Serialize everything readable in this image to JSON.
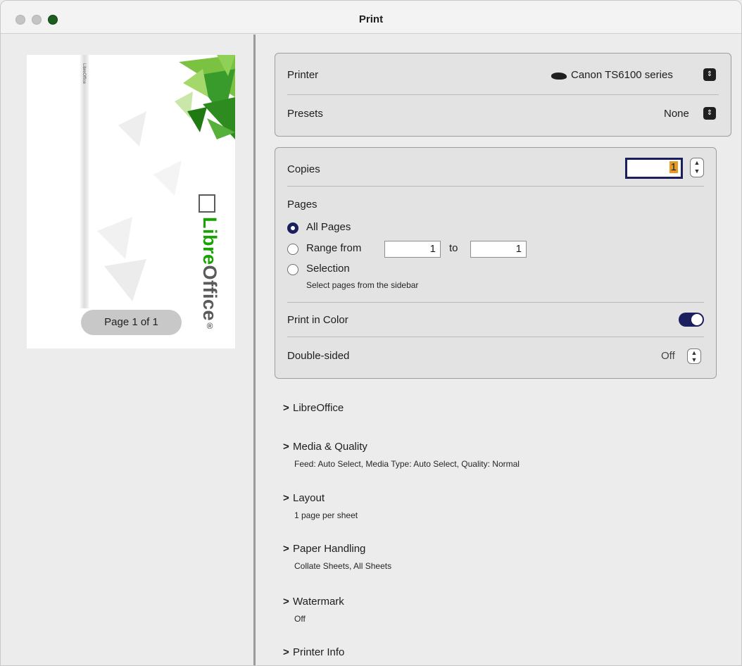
{
  "window": {
    "title": "Print"
  },
  "preview": {
    "spine_text": "LibreOffice",
    "logo_text_libre": "Libre",
    "logo_text_office": "Office",
    "logo_mark": "®",
    "page_indicator": "Page 1 of 1"
  },
  "printer_panel": {
    "printer_label": "Printer",
    "printer_value": "Canon TS6100 series",
    "presets_label": "Presets",
    "presets_value": "None"
  },
  "main_panel": {
    "copies_label": "Copies",
    "copies_value": "1",
    "pages_label": "Pages",
    "radio_all": "All Pages",
    "radio_range": "Range from",
    "range_from": "1",
    "range_to_label": "to",
    "range_to": "1",
    "radio_selection": "Selection",
    "selection_hint": "Select pages from the sidebar",
    "pages_selected": "All Pages",
    "print_in_color_label": "Print in Color",
    "print_in_color_on": true,
    "double_sided_label": "Double-sided",
    "double_sided_value": "Off"
  },
  "sections": [
    {
      "title": "LibreOffice",
      "subtitle": ""
    },
    {
      "title": "Media & Quality",
      "subtitle": "Feed: Auto Select, Media Type: Auto Select, Quality: Normal"
    },
    {
      "title": "Layout",
      "subtitle": "1 page per sheet"
    },
    {
      "title": "Paper Handling",
      "subtitle": "Collate Sheets, All Sheets"
    },
    {
      "title": "Watermark",
      "subtitle": "Off"
    },
    {
      "title": "Printer Info",
      "subtitle": ""
    }
  ],
  "colors": {
    "accent": "#1b1f5e",
    "libre_green": "#18a303",
    "close_button": "#1b5e20"
  }
}
